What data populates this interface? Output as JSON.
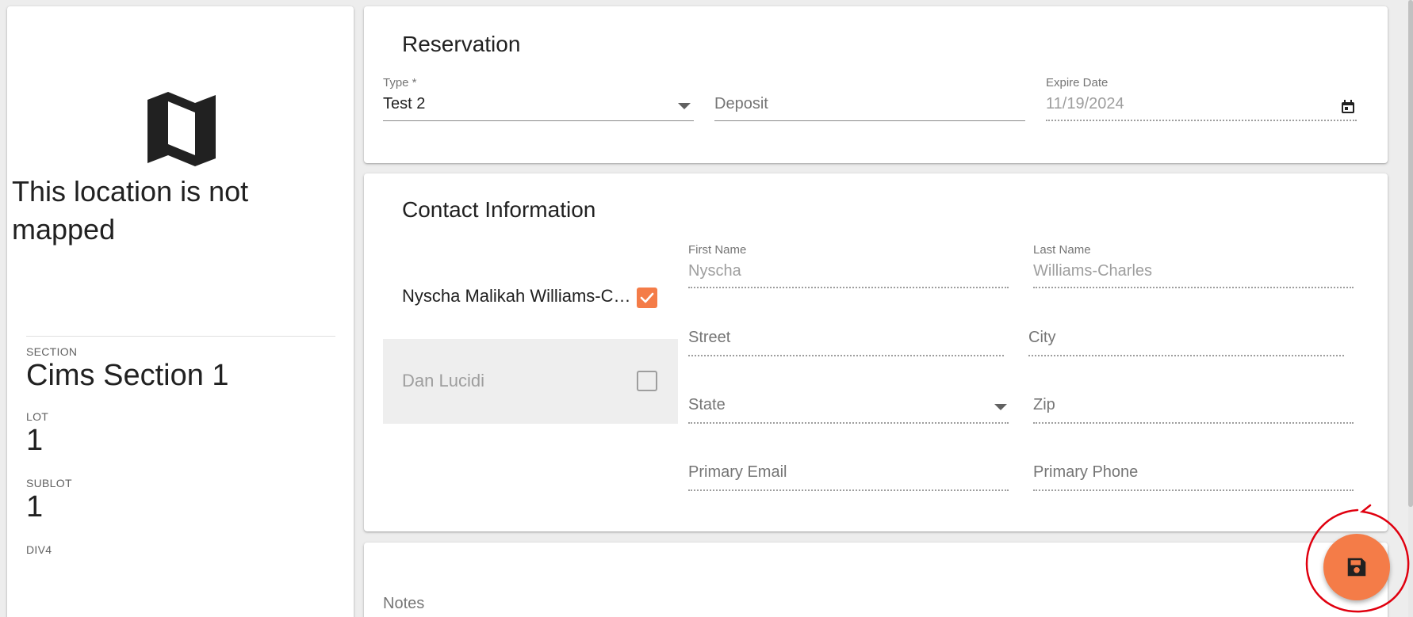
{
  "left_panel": {
    "icon": "map-icon",
    "not_mapped_text": "This location is not mapped",
    "section_label": "SECTION",
    "section_value": "Cims Section 1",
    "lot_label": "LOT",
    "lot_value": "1",
    "sublot_label": "SUBLOT",
    "sublot_value": "1",
    "div4_label": "DIV4"
  },
  "reservation": {
    "title": "Reservation",
    "type_label": "Type *",
    "type_value": "Test 2",
    "deposit_placeholder": "Deposit",
    "expire_label": "Expire Date",
    "expire_value": "11/19/2024"
  },
  "contact": {
    "title": "Contact Information",
    "contacts": [
      {
        "name": "Nyscha Malikah Williams-Charles",
        "checked": true
      },
      {
        "name": "Dan Lucidi",
        "checked": false
      }
    ],
    "first_name_label": "First Name",
    "first_name_value": "Nyscha",
    "last_name_label": "Last Name",
    "last_name_value": "Williams-Charles",
    "street_placeholder": "Street",
    "city_placeholder": "City",
    "state_placeholder": "State",
    "zip_placeholder": "Zip",
    "email_placeholder": "Primary Email",
    "phone_placeholder": "Primary Phone"
  },
  "notes": {
    "label": "Notes"
  },
  "fab": {
    "icon": "save-icon"
  },
  "colors": {
    "accent": "#f47c48",
    "annotation": "#e0000f"
  }
}
